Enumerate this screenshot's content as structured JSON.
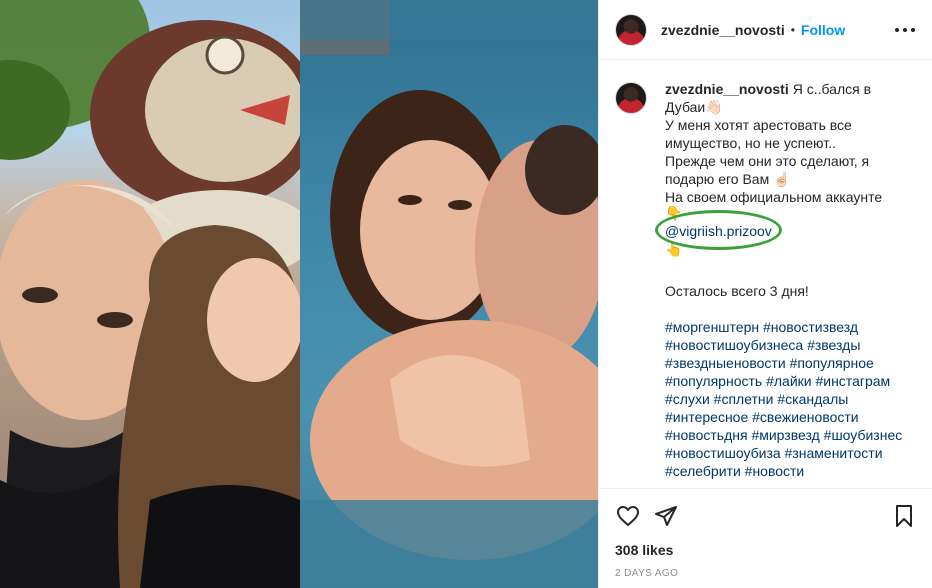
{
  "header": {
    "username": "zvezdnie__novosti",
    "separator": "•",
    "follow_label": "Follow"
  },
  "caption": {
    "username": "zvezdnie__novosti",
    "lines": [
      "Я с..бался в",
      "Дубаи👋🏻",
      "У меня хотят арестовать все",
      "имущество, но не успеют..",
      "Прежде чем они это сделают, я",
      "подарю его Вам ☝🏻",
      "На своем официальном аккаунте",
      "👇"
    ],
    "mention": "@vigriish.prizoov",
    "after_mention": "👆",
    "remaining": "Осталось всего 3 дня!",
    "hashtags": [
      "#моргенштерн #новостизвезд",
      "#новостишоубизнеса #звезды",
      "#звездныеновости #популярное",
      "#популярность #лайки #инстаграм",
      "#слухи #сплетни #скандалы",
      "#интересное #свежиеновости",
      "#новостьдня #мирзвезд #шоубизнес",
      "#новостишоубиза #знаменитости",
      "#селебрити #новости"
    ]
  },
  "actions": {
    "like_icon": "heart-icon",
    "share_icon": "paper-plane-icon",
    "save_icon": "bookmark-icon"
  },
  "likes": "308 likes",
  "date": "2 DAYS AGO",
  "colors": {
    "follow": "#0095f6",
    "link": "#00376b",
    "highlight_ring": "#3aa13a",
    "meta": "#8e8e8e"
  }
}
